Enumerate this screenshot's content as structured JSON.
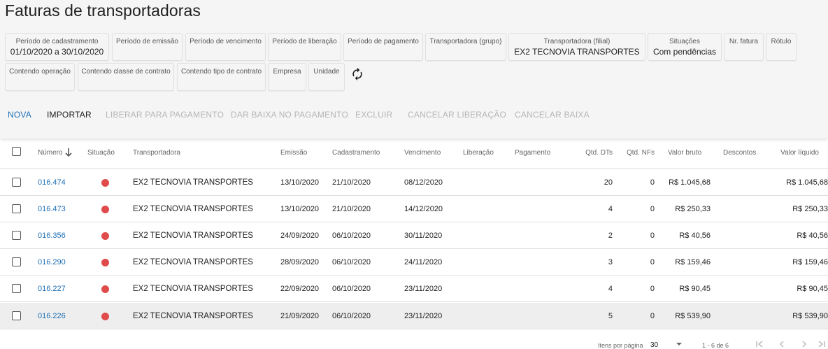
{
  "page": {
    "title": "Faturas de transportadoras"
  },
  "colors": {
    "accent": "#1e6fb5",
    "status_pending": "#e04b4b",
    "disabled": "#b6b6b6"
  },
  "filters": [
    {
      "label": "Período de cadastramento",
      "value": "01/10/2020 a 30/10/2020"
    },
    {
      "label": "Período de emissão",
      "value": ""
    },
    {
      "label": "Período de vencimento",
      "value": ""
    },
    {
      "label": "Período de liberação",
      "value": ""
    },
    {
      "label": "Período de pagamento",
      "value": ""
    },
    {
      "label": "Transportadora (grupo)",
      "value": ""
    },
    {
      "label": "Transportadora (filial)",
      "value": "EX2 TECNOVIA TRANSPORTES"
    },
    {
      "label": "Situações",
      "value": "Com pendências"
    },
    {
      "label": "Nr. fatura",
      "value": ""
    },
    {
      "label": "Rótulo",
      "value": ""
    },
    {
      "label": "Contendo operação",
      "value": ""
    },
    {
      "label": "Contendo classe de contrato",
      "value": ""
    },
    {
      "label": "Contendo tipo de contrato",
      "value": ""
    },
    {
      "label": "Empresa",
      "value": ""
    },
    {
      "label": "Unidade",
      "value": ""
    }
  ],
  "refresh_icon": "refresh-icon",
  "actions": {
    "nova": "NOVA",
    "importar": "IMPORTAR",
    "liberar": "LIBERAR PARA PAGAMENTO",
    "dar_baixa": "DAR BAIXA NO PAGAMENTO",
    "excluir": "EXCLUIR",
    "cancelar_liberacao": "CANCELAR LIBERAÇÃO",
    "cancelar_baixa": "CANCELAR BAIXA"
  },
  "table": {
    "headers": {
      "numero": "Número",
      "situacao": "Situação",
      "transportadora": "Transportadora",
      "emissao": "Emissão",
      "cadastramento": "Cadastramento",
      "vencimento": "Vencimento",
      "liberacao": "Liberação",
      "pagamento": "Pagamento",
      "qtd_dts": "Qtd. DTs",
      "qtd_nfs": "Qtd. NFs",
      "valor_bruto": "Valor bruto",
      "descontos": "Descontos",
      "valor_liquido": "Valor líquido"
    },
    "sort_icon": "arrow-down-icon",
    "rows": [
      {
        "numero": "016.474",
        "status": "pending",
        "transportadora": "EX2 TECNOVIA TRANSPORTES",
        "emissao": "13/10/2020",
        "cadastramento": "21/10/2020",
        "vencimento": "08/12/2020",
        "liberacao": "",
        "pagamento": "",
        "qtd_dts": "20",
        "qtd_nfs": "0",
        "valor_bruto": "R$ 1.045,68",
        "descontos": "",
        "valor_liquido": "R$ 1.045,68"
      },
      {
        "numero": "016.473",
        "status": "pending",
        "transportadora": "EX2 TECNOVIA TRANSPORTES",
        "emissao": "13/10/2020",
        "cadastramento": "21/10/2020",
        "vencimento": "14/12/2020",
        "liberacao": "",
        "pagamento": "",
        "qtd_dts": "4",
        "qtd_nfs": "0",
        "valor_bruto": "R$ 250,33",
        "descontos": "",
        "valor_liquido": "R$ 250,33"
      },
      {
        "numero": "016.356",
        "status": "pending",
        "transportadora": "EX2 TECNOVIA TRANSPORTES",
        "emissao": "24/09/2020",
        "cadastramento": "06/10/2020",
        "vencimento": "30/11/2020",
        "liberacao": "",
        "pagamento": "",
        "qtd_dts": "2",
        "qtd_nfs": "0",
        "valor_bruto": "R$ 40,56",
        "descontos": "",
        "valor_liquido": "R$ 40,56"
      },
      {
        "numero": "016.290",
        "status": "pending",
        "transportadora": "EX2 TECNOVIA TRANSPORTES",
        "emissao": "28/09/2020",
        "cadastramento": "06/10/2020",
        "vencimento": "24/11/2020",
        "liberacao": "",
        "pagamento": "",
        "qtd_dts": "3",
        "qtd_nfs": "0",
        "valor_bruto": "R$ 159,46",
        "descontos": "",
        "valor_liquido": "R$ 159,46"
      },
      {
        "numero": "016.227",
        "status": "pending",
        "transportadora": "EX2 TECNOVIA TRANSPORTES",
        "emissao": "22/09/2020",
        "cadastramento": "06/10/2020",
        "vencimento": "23/11/2020",
        "liberacao": "",
        "pagamento": "",
        "qtd_dts": "4",
        "qtd_nfs": "0",
        "valor_bruto": "R$ 90,45",
        "descontos": "",
        "valor_liquido": "R$ 90,45"
      },
      {
        "numero": "016.226",
        "status": "pending",
        "transportadora": "EX2 TECNOVIA TRANSPORTES",
        "emissao": "21/09/2020",
        "cadastramento": "06/10/2020",
        "vencimento": "23/11/2020",
        "liberacao": "",
        "pagamento": "",
        "qtd_dts": "5",
        "qtd_nfs": "0",
        "valor_bruto": "R$ 539,90",
        "descontos": "",
        "valor_liquido": "R$ 539,90"
      }
    ]
  },
  "footer": {
    "items_per_page_label": "Itens por página",
    "items_per_page_value": "30",
    "range": "1 - 6 de 6"
  }
}
